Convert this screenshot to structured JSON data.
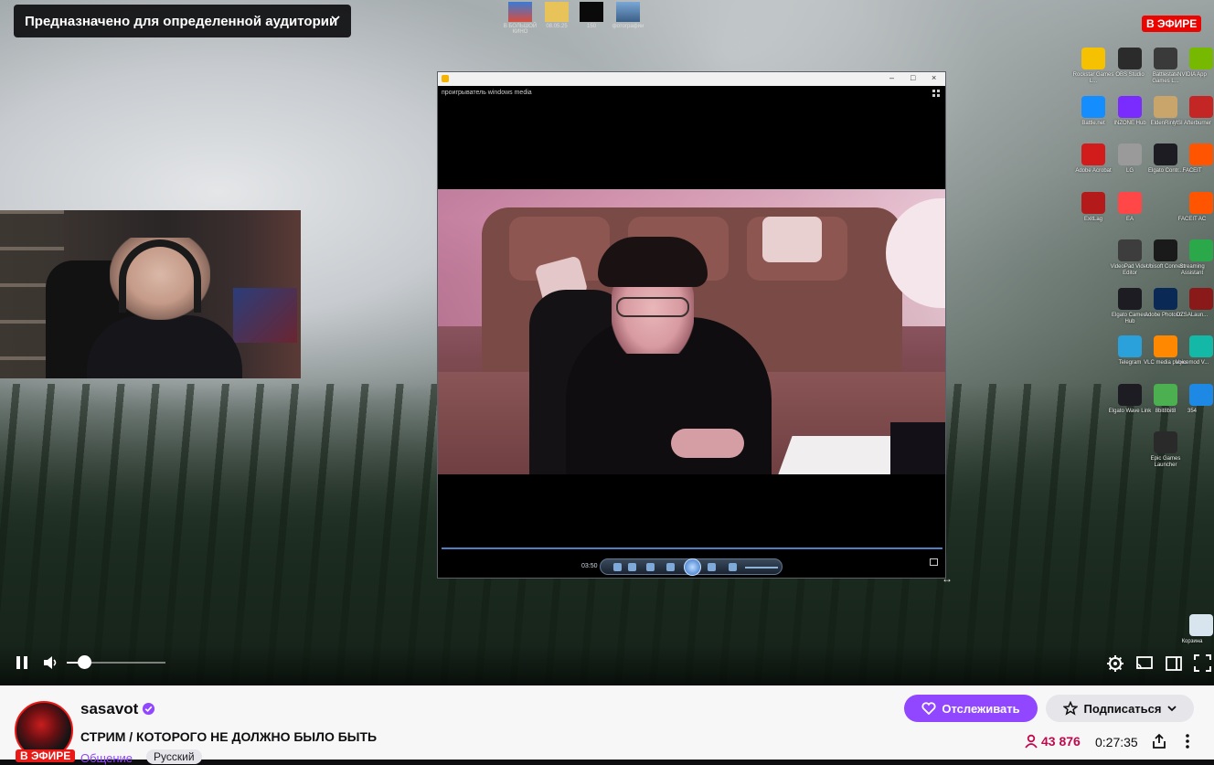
{
  "player": {
    "audience_label": "Предназначено для определенной аудитории",
    "live_badge": "В ЭФИРЕ",
    "volume_level": 0.18,
    "desktop_top_icons": [
      {
        "label": "В БОЛЬШОЙ КИНО"
      },
      {
        "label": "08.05.25"
      },
      {
        "label": "150"
      },
      {
        "label": "фотографии"
      }
    ],
    "desktop_icons": [
      {
        "label": "Rockstar Games L...",
        "color": "#f6c100"
      },
      {
        "label": "OBS Studio",
        "color": "#2b2b2b"
      },
      {
        "label": "Battlestate Games L...",
        "color": "#3a3a3a"
      },
      {
        "label": "NVIDIA App",
        "color": "#76b900"
      },
      {
        "label": "Battle.net",
        "color": "#148eff"
      },
      {
        "label": "INZONE Hub",
        "color": "#7a2cff"
      },
      {
        "label": "EldenRing...",
        "color": "#c9a56b"
      },
      {
        "label": "MSI Afterburner",
        "color": "#c42626"
      },
      {
        "label": "Adobe Acrobat",
        "color": "#d21c1c"
      },
      {
        "label": "LG",
        "color": "#9a9a9a"
      },
      {
        "label": "Elgato Contr...",
        "color": "#1c1c22"
      },
      {
        "label": "FACEIT",
        "color": "#ff5500"
      },
      {
        "label": "ExitLag",
        "color": "#b51a1a"
      },
      {
        "label": "EA",
        "color": "#ff4747"
      },
      {
        "label": "FACEIT AC",
        "color": "#ff5500"
      },
      {
        "label": "VideoPad Video Editor",
        "color": "#3d3d3d"
      },
      {
        "label": "Ubisoft Connect",
        "color": "#1a1a1a"
      },
      {
        "label": "Streaming Assistant",
        "color": "#2aa84a"
      },
      {
        "label": "Elgato Camera Hub",
        "color": "#1c1c22"
      },
      {
        "label": "Adobe Photosh...",
        "color": "#0a2a55"
      },
      {
        "label": "DZSALaun...",
        "color": "#8a1a1a"
      },
      {
        "label": "Telegram",
        "color": "#2aa1da"
      },
      {
        "label": "VLC media player",
        "color": "#ff8800"
      },
      {
        "label": "Voicemod V...",
        "color": "#14b8a6"
      },
      {
        "label": "Elgato Wave Link",
        "color": "#1c1c22"
      },
      {
        "label": "8bit8bit8",
        "color": "#4caf50"
      },
      {
        "label": "354",
        "color": "#1e88e5"
      },
      {
        "label": "Epic Games Launcher",
        "color": "#2a2a2a"
      },
      {
        "label": "Корзина",
        "color": "#d8e4ee"
      }
    ],
    "media_window": {
      "title": "проигрыватель windows media",
      "time": "03:50"
    }
  },
  "channel": {
    "name": "sasavot",
    "live_badge": "В ЭФИРЕ",
    "stream_title": "СТРИМ / КОТОРОГО НЕ ДОЛЖНО БЫЛО БЫТЬ",
    "category": "Общение",
    "tag": "Русский",
    "follow_label": "Отслеживать",
    "subscribe_label": "Подписаться",
    "viewers": "43 876",
    "uptime": "0:27:35"
  },
  "colors": {
    "accent": "#9147ff",
    "live": "#eb0400",
    "viewers": "#be0a4d"
  }
}
